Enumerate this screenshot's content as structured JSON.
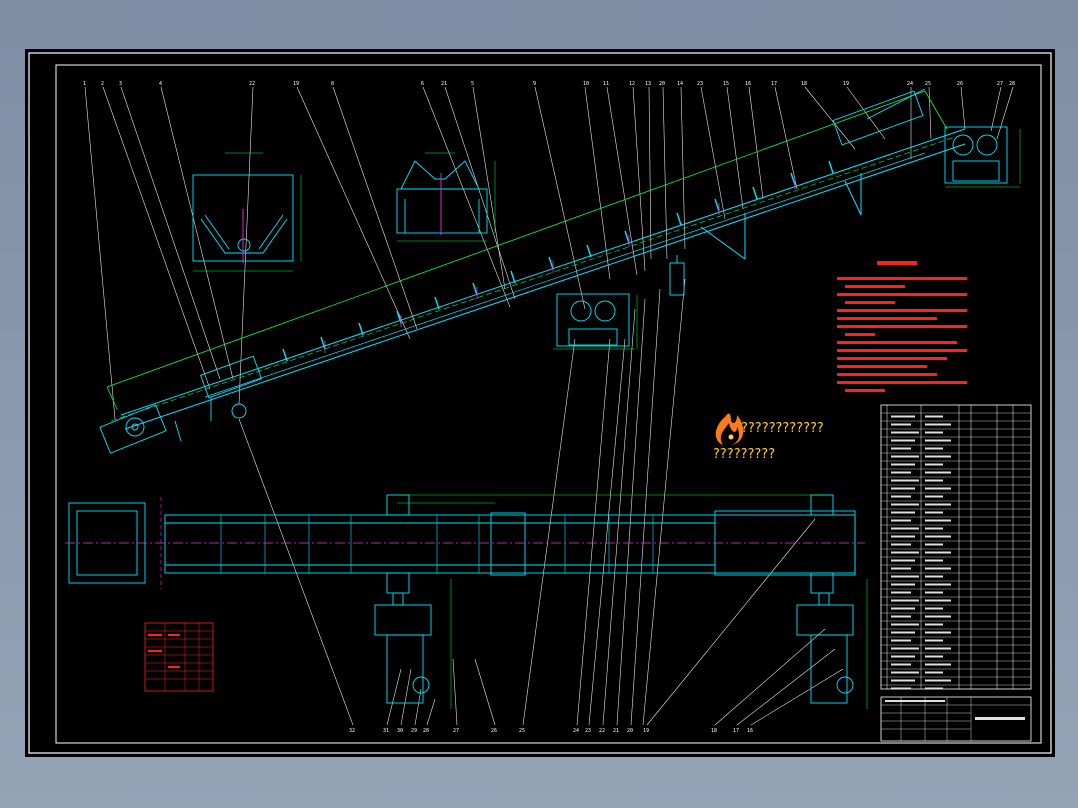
{
  "watermark": {
    "line1": "????????????",
    "line2": "?????????",
    "logo_icon": "flame-logo-icon"
  },
  "drawing": {
    "balloon_labels_top": [
      "1",
      "2",
      "3",
      "4",
      "22",
      "19",
      "8",
      "6",
      "21",
      "5",
      "9",
      "10",
      "11",
      "12",
      "13",
      "20",
      "14",
      "23",
      "15",
      "16",
      "17",
      "18",
      "19",
      "24",
      "25",
      "26",
      "27"
    ],
    "balloon_labels_bottom": [
      "32",
      "31",
      "30",
      "29",
      "28",
      "27",
      "26",
      "25",
      "24",
      "23",
      "22",
      "21",
      "20",
      "19",
      "18"
    ]
  },
  "colors": {
    "sheet": "#000000",
    "frame": "#ffffff",
    "cyan": "#00e5ff",
    "green": "#00ff3c",
    "magenta": "#ff2bd6",
    "red": "#ff2020",
    "orange": "#ff7a1a"
  }
}
